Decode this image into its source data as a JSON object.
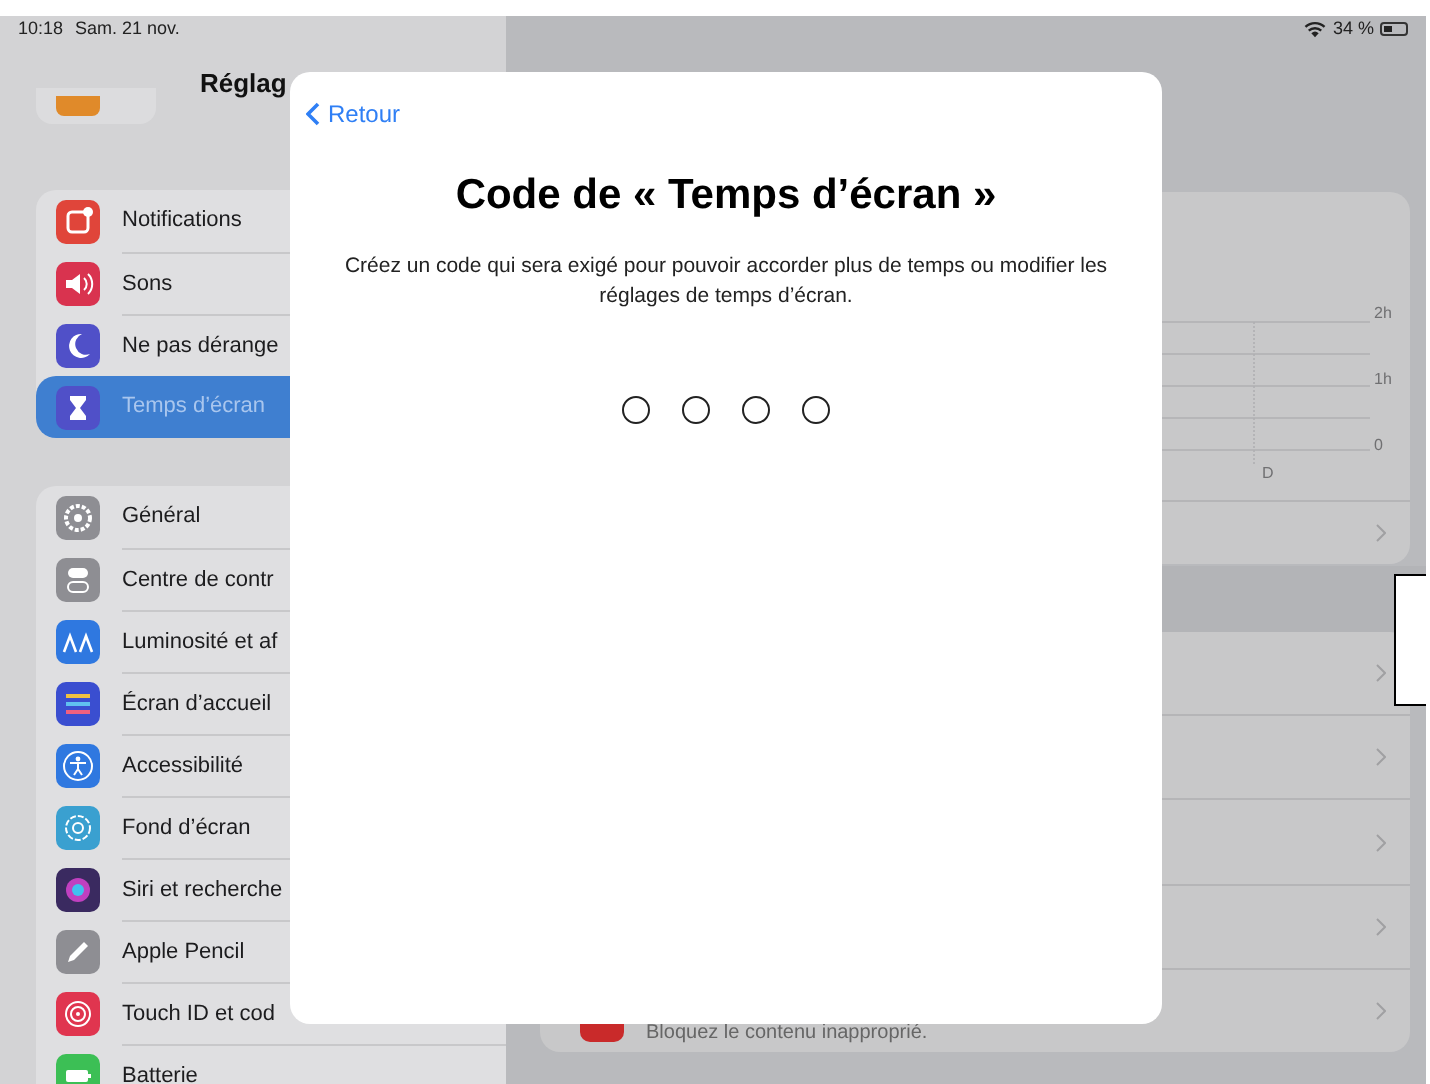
{
  "status_bar": {
    "time": "10:18",
    "date": "Sam. 21 nov.",
    "battery": "34 %"
  },
  "sidebar": {
    "title": "Réglag",
    "groups": [
      {
        "items": [
          {
            "label": "Notifications",
            "selected": false
          },
          {
            "label": "Sons",
            "selected": false
          },
          {
            "label": "Ne pas dérange",
            "selected": false
          },
          {
            "label": "Temps d’écran",
            "selected": true
          }
        ]
      },
      {
        "items": [
          {
            "label": "Général",
            "selected": false
          },
          {
            "label": "Centre de contr",
            "selected": false
          },
          {
            "label": "Luminosité et af",
            "selected": false
          },
          {
            "label": "Écran d’accueil",
            "selected": false
          },
          {
            "label": "Accessibilité",
            "selected": false
          },
          {
            "label": "Fond d’écran",
            "selected": false
          },
          {
            "label": "Siri et recherche",
            "selected": false
          },
          {
            "label": "Apple Pencil",
            "selected": false
          },
          {
            "label": "Touch ID et cod",
            "selected": false
          },
          {
            "label": "Batterie",
            "selected": false
          }
        ]
      }
    ]
  },
  "detail": {
    "chart_labels": [
      "2h",
      "1h",
      "0"
    ],
    "day_label": "D",
    "rows": [
      {
        "kind": "link"
      },
      {
        "kind": "link"
      },
      {
        "kind": "link"
      },
      {
        "kind": "link"
      },
      {
        "kind": "link"
      },
      {
        "kind": "link",
        "subtitle": "Bloquez le contenu inapproprié."
      }
    ]
  },
  "modal": {
    "back": "Retour",
    "title": "Code de « Temps d’écran »",
    "message": "Créez un code qui sera exigé pour pouvoir accorder plus de temps ou modifier les réglages de temps d’écran.",
    "code_slots": [
      {
        "filled": false
      },
      {
        "filled": false
      },
      {
        "filled": false
      },
      {
        "filled": false
      }
    ]
  }
}
